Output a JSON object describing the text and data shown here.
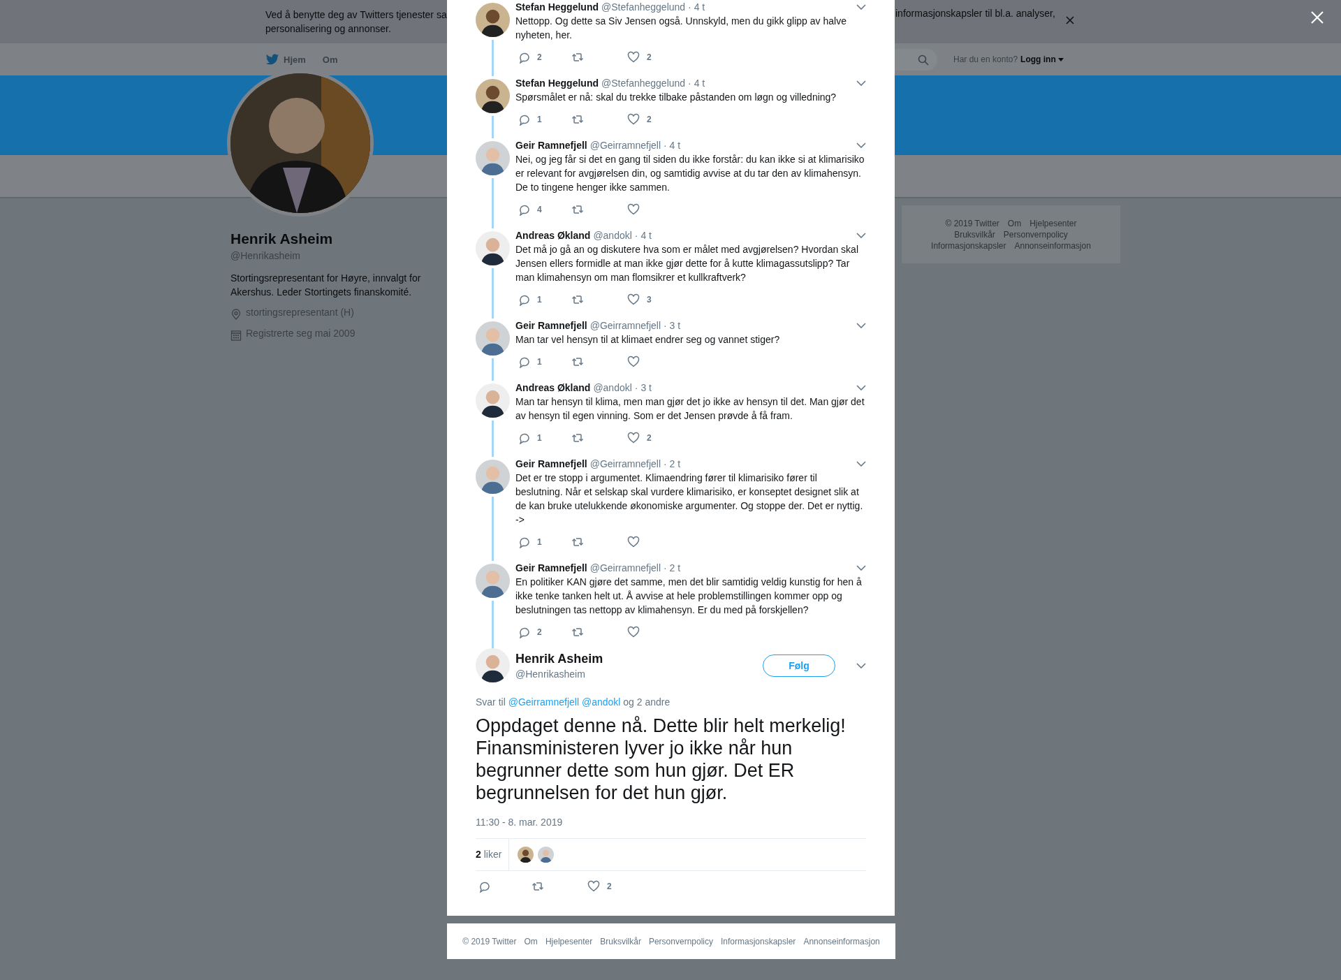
{
  "cookie_banner": {
    "texts": [
      "Ved å benytte deg av Twitters tjenester sa",
      "personalisering og annonser."
    ],
    "text_right": "informasjonskapsler til bl.a. analyser,"
  },
  "nav": {
    "items": [
      "Hjem",
      "Om"
    ],
    "login_prompt": "Har du en konto?",
    "login": "Logg inn"
  },
  "profile": {
    "name": "Henrik Asheim",
    "handle": "@Henrikasheim",
    "bio": "Stortingsrepresentant for Høyre, innvalgt for Akershus. Leder Stortingets finanskomité.",
    "location": "stortingsrepresentant (H)",
    "joined": "Registrerte seg mai 2009"
  },
  "sidebar_footer": {
    "links": [
      "© 2019 Twitter",
      "Om",
      "Hjelpesenter",
      "Bruksvilkår",
      "Personvernpolicy",
      "Informasjonskapsler",
      "Annonseinformasjon"
    ]
  },
  "thread": {
    "replies": [
      {
        "name": "Stefan Heggelund",
        "handle": "@Stefanheggelund",
        "time": "· 4 t",
        "text": "Nettopp. Og dette sa Siv Jensen også. Unnskyld, men du gikk glipp av halve nyheten, her.",
        "replies": "2",
        "likes": "2"
      },
      {
        "name": "Stefan Heggelund",
        "handle": "@Stefanheggelund",
        "time": "· 4 t",
        "text": "Spørsmålet er nå: skal du trekke tilbake påstanden om løgn og villedning?",
        "replies": "1",
        "likes": "2"
      },
      {
        "name": "Geir Ramnefjell",
        "handle": "@Geirramnefjell",
        "time": "· 4 t",
        "text": "Nei, og jeg får si det en gang til siden du ikke forstår: du kan ikke si at klimarisiko er relevant for avgjørelsen din, og samtidig avvise at du tar den av klimahensyn. De to tingene henger ikke sammen.",
        "replies": "4"
      },
      {
        "name": "Andreas Økland",
        "handle": "@andokl",
        "time": "· 4 t",
        "text": "Det må jo gå an og diskutere hva som er målet med avgjørelsen? Hvordan skal Jensen ellers formidle at man ikke gjør dette for å kutte klimagassutslipp? Tar man klimahensyn om man flomsikrer et kullkraftverk?",
        "replies": "1",
        "likes": "3"
      },
      {
        "name": "Geir Ramnefjell",
        "handle": "@Geirramnefjell",
        "time": "· 3 t",
        "text": "Man tar vel hensyn til at klimaet endrer seg og vannet stiger?",
        "replies": "1"
      },
      {
        "name": "Andreas Økland",
        "handle": "@andokl",
        "time": "· 3 t",
        "text": "Man tar hensyn til klima, men man gjør det jo ikke av hensyn til det. Man gjør det av hensyn til egen vinning. Som er det Jensen prøvde å få fram.",
        "replies": "1",
        "likes": "2"
      },
      {
        "name": "Geir Ramnefjell",
        "handle": "@Geirramnefjell",
        "time": "· 2 t",
        "text": "Det er tre stopp i argumentet. Klimaendring fører til klimarisiko fører til beslutning. Når et selskap skal vurdere klimarisiko, er konseptet designet slik at de kan bruke utelukkende økonomiske argumenter. Og stoppe der. Det er nyttig. ->",
        "replies": "1"
      },
      {
        "name": "Geir Ramnefjell",
        "handle": "@Geirramnefjell",
        "time": "· 2 t",
        "text": "En politiker KAN gjøre det samme, men det blir samtidig veldig kunstig for hen å ikke tenke tanken helt ut. Å avvise at hele problemstillingen kommer opp og beslutningen tas nettopp av klimahensyn. Er du med på forskjellen?",
        "replies": "2"
      }
    ],
    "focused": {
      "name": "Henrik Asheim",
      "handle": "@Henrikasheim",
      "follow": "Følg",
      "reply_prefix": "Svar til",
      "mentions": [
        "@Geirramnefjell",
        "@andokl"
      ],
      "reply_suffix": "og 2 andre",
      "text": "Oppdaget denne nå. Dette blir helt merkelig! Finansministeren lyver jo ikke når hun begrunner dette som hun gjør. Det ER begrunnelsen for det hun gjør.",
      "timestamp": "11:30 - 8. mar. 2019",
      "like_summary": "**2** liker",
      "likes": "2"
    }
  },
  "modal_footer": {
    "links": [
      "© 2019 Twitter",
      "Om",
      "Hjelpesenter",
      "Bruksvilkår",
      "Personvernpolicy",
      "Informasjonskapsler",
      "Annonseinformasjon"
    ]
  }
}
